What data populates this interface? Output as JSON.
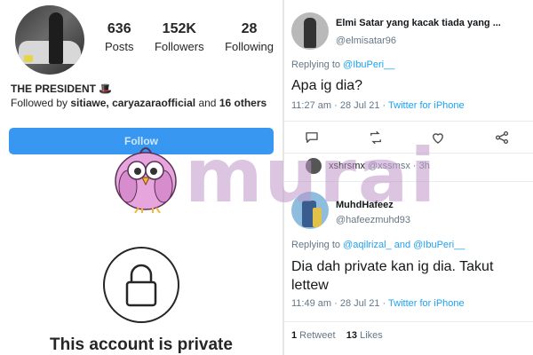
{
  "instagram": {
    "stats": [
      {
        "num": "636",
        "label": "Posts"
      },
      {
        "num": "152K",
        "label": "Followers"
      },
      {
        "num": "28",
        "label": "Following"
      }
    ],
    "profile_name": "THE PRESIDENT 🎩",
    "followed_by_prefix": "Followed by ",
    "followed_by_names": "sitiawe, caryazaraofficial",
    "followed_by_and": " and ",
    "followed_by_others": "16 others",
    "follow_label": "Follow",
    "private_text": "This account is private"
  },
  "twitter": {
    "tweet1": {
      "name": "Elmi Satar yang kacak tiada yang ...",
      "handle": "@elmisatar96",
      "replying_prefix": "Replying to ",
      "replying_to": "@IbuPeri__",
      "text": "Apa ig dia?",
      "time": "11:27 am · 28 Jul 21 · ",
      "source": "Twitter for iPhone"
    },
    "mini_reply": {
      "name": "xshrsmx",
      "handle": "@xssmsx · 3h"
    },
    "tweet2": {
      "name": "MuhdHafeez",
      "handle": "@hafeezmuhd93",
      "replying_prefix": "Replying to ",
      "replying_to": "@aqilrizal_ and @IbuPeri__",
      "text": "Dia dah private kan ig dia. Takut lettew",
      "time": "11:49 am · 28 Jul 21 · ",
      "source": "Twitter for iPhone",
      "retweets_num": "1",
      "retweets_label": " Retweet",
      "likes_num": "13",
      "likes_label": " Likes"
    },
    "action_icons": [
      "comment-icon",
      "retweet-icon",
      "like-icon",
      "share-icon"
    ]
  },
  "watermark": {
    "text": "murai",
    "color": "#be96c8"
  }
}
